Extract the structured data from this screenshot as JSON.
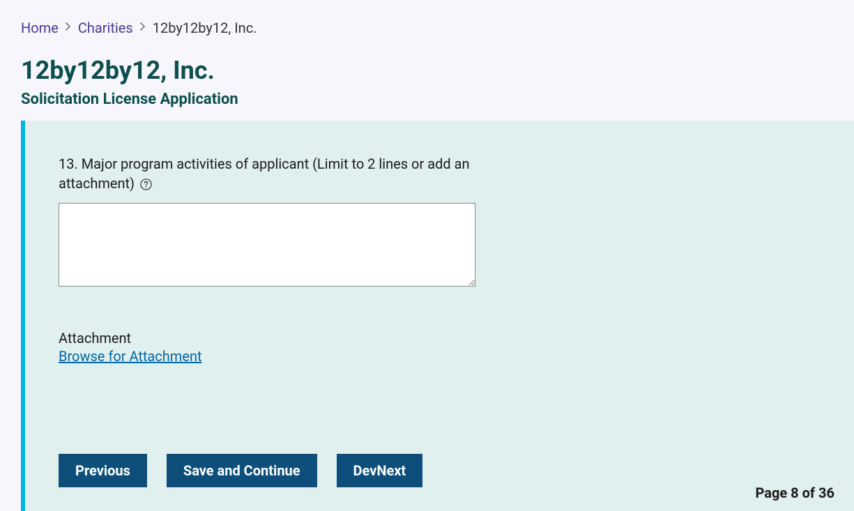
{
  "breadcrumb": {
    "home": "Home",
    "charities": "Charities",
    "current": "12by12by12, Inc."
  },
  "header": {
    "title": "12by12by12, Inc.",
    "subtitle": "Solicitation License Application"
  },
  "form": {
    "question_label": "13. Major program activities of applicant (Limit to 2 lines or add an attachment)",
    "textarea_value": "",
    "attachment_label": "Attachment",
    "browse_label": "Browse for Attachment"
  },
  "buttons": {
    "previous": "Previous",
    "save_continue": "Save and Continue",
    "devnext": "DevNext"
  },
  "pagination": {
    "text": "Page 8 of 36"
  }
}
